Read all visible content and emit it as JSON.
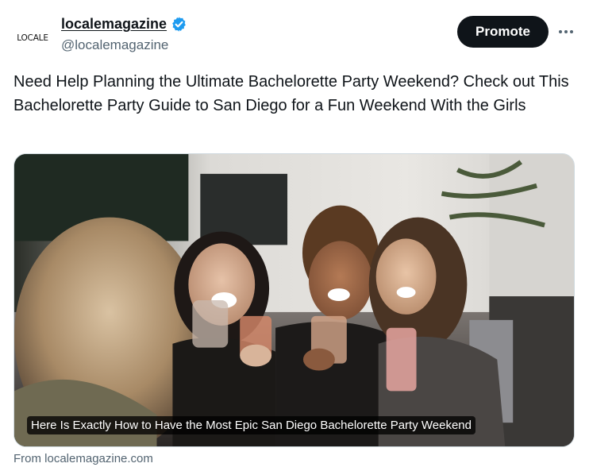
{
  "author": {
    "avatar_text": "LOCALE",
    "display_name": "localemagazine",
    "handle": "@localemagazine",
    "verified_icon": "verified-badge-icon",
    "verified_color": "#1d9bf0"
  },
  "actions": {
    "promote_label": "Promote",
    "more_icon": "more-horizontal-icon"
  },
  "tweet": {
    "text": "Need Help Planning the Ultimate Bachelorette Party Weekend? Check out This Bachelorette Party Guide to San Diego for a Fun Weekend With the Girls"
  },
  "card": {
    "title": "Here Is Exactly How to Have the Most Epic San Diego Bachelorette Party Weekend",
    "source": "From localemagazine.com"
  }
}
